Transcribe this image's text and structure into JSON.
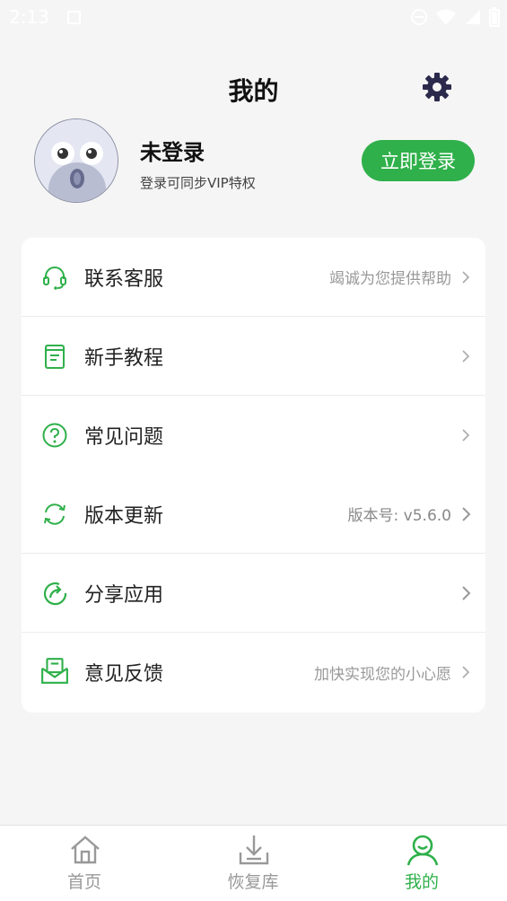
{
  "status_bar": {
    "time": "2:13"
  },
  "header": {
    "title": "我的"
  },
  "profile": {
    "name": "未登录",
    "subtitle": "登录可同步VIP特权",
    "login_label": "立即登录"
  },
  "menu": {
    "items": [
      {
        "label": "联系客服",
        "hint": "竭诚为您提供帮助",
        "icon": "headset-icon"
      },
      {
        "label": "新手教程",
        "hint": "",
        "icon": "book-icon"
      },
      {
        "label": "常见问题",
        "hint": "",
        "icon": "question-icon"
      },
      {
        "label": "版本更新",
        "hint": "版本号: v5.6.0",
        "icon": "refresh-icon"
      },
      {
        "label": "分享应用",
        "hint": "",
        "icon": "share-icon"
      },
      {
        "label": "意见反馈",
        "hint": "加快实现您的小心愿",
        "icon": "feedback-mail-icon"
      }
    ]
  },
  "bottom_nav": {
    "items": [
      {
        "label": "首页",
        "icon": "home-icon",
        "active": false
      },
      {
        "label": "恢复库",
        "icon": "download-icon",
        "active": false
      },
      {
        "label": "我的",
        "icon": "user-icon",
        "active": true
      }
    ]
  },
  "colors": {
    "accent": "#2fb04a",
    "background": "#f5f5f5",
    "hint": "#999999"
  }
}
